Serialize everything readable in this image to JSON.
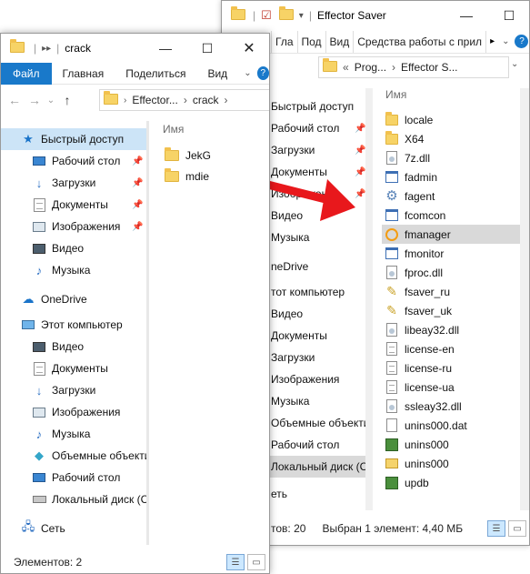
{
  "arrow_color": "#e8181c",
  "windowB": {
    "title": "Effector Saver",
    "ribbon_tabs": [
      "Гла",
      "Под",
      "Вид",
      "Средства работы с прил"
    ],
    "address_path": [
      "«",
      "Prog...",
      "›",
      "Effector S..."
    ],
    "column_name": "Имя",
    "nav": [
      "Быстрый доступ",
      "Рабочий стол",
      "Загрузки",
      "Документы",
      "Изображения",
      "Видео",
      "Музыка",
      "neDrive",
      "тот компьютер",
      "Видео",
      "Документы",
      "Загрузки",
      "Изображения",
      "Музыка",
      "Объемные объекти",
      "Рабочий стол",
      "Локальный диск (С",
      "еть"
    ],
    "files": [
      {
        "name": "locale",
        "icon": "folder-icon"
      },
      {
        "name": "X64",
        "icon": "folder-icon"
      },
      {
        "name": "7z.dll",
        "icon": "dll-file-icon"
      },
      {
        "name": "fadmin",
        "icon": "application-icon"
      },
      {
        "name": "fagent",
        "icon": "gear-icon"
      },
      {
        "name": "fcomcon",
        "icon": "application-icon"
      },
      {
        "name": "fmanager",
        "icon": "fmanager-app-icon"
      },
      {
        "name": "fmonitor",
        "icon": "application-icon"
      },
      {
        "name": "fproc.dll",
        "icon": "dll-file-icon"
      },
      {
        "name": "fsaver_ru",
        "icon": "certificate-file-icon"
      },
      {
        "name": "fsaver_uk",
        "icon": "certificate-file-icon"
      },
      {
        "name": "libeay32.dll",
        "icon": "dll-file-icon"
      },
      {
        "name": "license-en",
        "icon": "text-file-icon"
      },
      {
        "name": "license-ru",
        "icon": "text-file-icon"
      },
      {
        "name": "license-ua",
        "icon": "text-file-icon"
      },
      {
        "name": "ssleay32.dll",
        "icon": "dll-file-icon"
      },
      {
        "name": "unins000.dat",
        "icon": "blank-file-icon"
      },
      {
        "name": "unins000",
        "icon": "installer-icon"
      },
      {
        "name": "unins000",
        "icon": "mail-file-icon"
      },
      {
        "name": "updb",
        "icon": "installer-icon"
      }
    ],
    "selected_file": "fmanager",
    "status_items": "тов: 20",
    "status_selected": "Выбран 1 элемент: 4,40 МБ"
  },
  "windowA": {
    "title": "crack",
    "ribbon_tabs": [
      "Файл",
      "Главная",
      "Поделиться",
      "Вид"
    ],
    "address_path": [
      "Effector...",
      "›",
      "crack",
      "›"
    ],
    "column_name": "Имя",
    "nav": [
      {
        "label": "Быстрый доступ",
        "icon": "star-icon"
      },
      {
        "label": "Рабочий стол",
        "icon": "desktop-icon"
      },
      {
        "label": "Загрузки",
        "icon": "download-icon"
      },
      {
        "label": "Документы",
        "icon": "documents-icon"
      },
      {
        "label": "Изображения",
        "icon": "pictures-icon"
      },
      {
        "label": "Видео",
        "icon": "video-icon"
      },
      {
        "label": "Музыка",
        "icon": "music-icon"
      },
      {
        "label": "OneDrive",
        "icon": "cloud-icon"
      },
      {
        "label": "Этот компьютер",
        "icon": "computer-icon"
      },
      {
        "label": "Видео",
        "icon": "video-icon"
      },
      {
        "label": "Документы",
        "icon": "documents-icon"
      },
      {
        "label": "Загрузки",
        "icon": "download-icon"
      },
      {
        "label": "Изображения",
        "icon": "pictures-icon"
      },
      {
        "label": "Музыка",
        "icon": "music-icon"
      },
      {
        "label": "Объемные объекти",
        "icon": "3d-objects-icon"
      },
      {
        "label": "Рабочий стол",
        "icon": "desktop-icon"
      },
      {
        "label": "Локальный диск (С",
        "icon": "disk-icon"
      },
      {
        "label": "Сеть",
        "icon": "network-icon"
      }
    ],
    "files": [
      {
        "name": "JekG",
        "icon": "folder-icon"
      },
      {
        "name": "mdie",
        "icon": "folder-icon"
      }
    ],
    "status_items": "Элементов: 2"
  }
}
